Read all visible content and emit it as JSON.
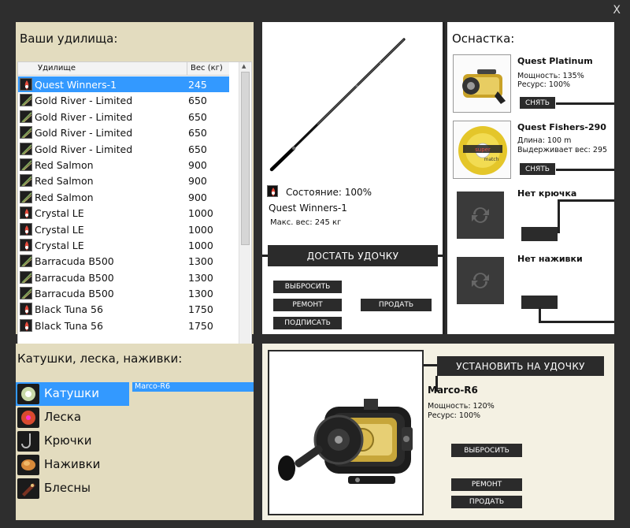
{
  "window": {
    "close_label": "X"
  },
  "rods": {
    "title": "Ваши удилища:",
    "col_name": "Удилище",
    "col_weight": "Вес (кг)",
    "items": [
      {
        "name": "Quest Winners-1",
        "weight": "245"
      },
      {
        "name": "Gold River - Limited",
        "weight": "650"
      },
      {
        "name": "Gold River - Limited",
        "weight": "650"
      },
      {
        "name": "Gold River - Limited",
        "weight": "650"
      },
      {
        "name": "Gold River - Limited",
        "weight": "650"
      },
      {
        "name": "Red Salmon",
        "weight": "900"
      },
      {
        "name": "Red Salmon",
        "weight": "900"
      },
      {
        "name": "Red Salmon",
        "weight": "900"
      },
      {
        "name": "Crystal LE",
        "weight": "1000"
      },
      {
        "name": "Crystal LE",
        "weight": "1000"
      },
      {
        "name": "Crystal LE",
        "weight": "1000"
      },
      {
        "name": "Barracuda B500",
        "weight": "1300"
      },
      {
        "name": "Barracuda B500",
        "weight": "1300"
      },
      {
        "name": "Barracuda B500",
        "weight": "1300"
      },
      {
        "name": "Black Tuna 56",
        "weight": "1750"
      },
      {
        "name": "Black Tuna 56",
        "weight": "1750"
      }
    ]
  },
  "rod_detail": {
    "condition": "Состояние: 100%",
    "name": "Quest Winners-1",
    "max_weight": "Макс. вес: 245 кг",
    "take_label": "ДОСТАТЬ УДОЧКУ",
    "discard_label": "ВЫБРОСИТЬ",
    "repair_label": "РЕМОНТ",
    "sign_label": "ПОДПИСАТЬ",
    "sell_label": "ПРОДАТЬ"
  },
  "tackle": {
    "title": "Оснастка:",
    "reel": {
      "name": "Quest Platinum",
      "power": "Мощность: 135%",
      "resource": "Ресурс: 100%",
      "remove_label": "СНЯТЬ"
    },
    "line": {
      "name": "Quest Fishers-290",
      "length": "Длина: 100 m",
      "holds": "Выдерживает вес: 295",
      "remove_label": "СНЯТЬ",
      "brand_text": "super",
      "brand_text2": "match"
    },
    "hook": {
      "label": "Нет крючка"
    },
    "bait": {
      "label": "Нет наживки"
    }
  },
  "categories": {
    "title": "Катушки, леска, наживки:",
    "items": [
      {
        "label": "Катушки"
      },
      {
        "label": "Леска"
      },
      {
        "label": "Крючки"
      },
      {
        "label": "Наживки"
      },
      {
        "label": "Блесны"
      }
    ],
    "sub_items": [
      {
        "label": "Marco-R6"
      }
    ]
  },
  "selected_item": {
    "install_label": "УСТАНОВИТЬ НА УДОЧКУ",
    "name": "Marco-R6",
    "power": "Мощность: 120%",
    "resource": "Ресурс: 100%",
    "discard_label": "ВЫБРОСИТЬ",
    "repair_label": "РЕМОНТ",
    "sell_label": "ПРОДАТЬ"
  }
}
